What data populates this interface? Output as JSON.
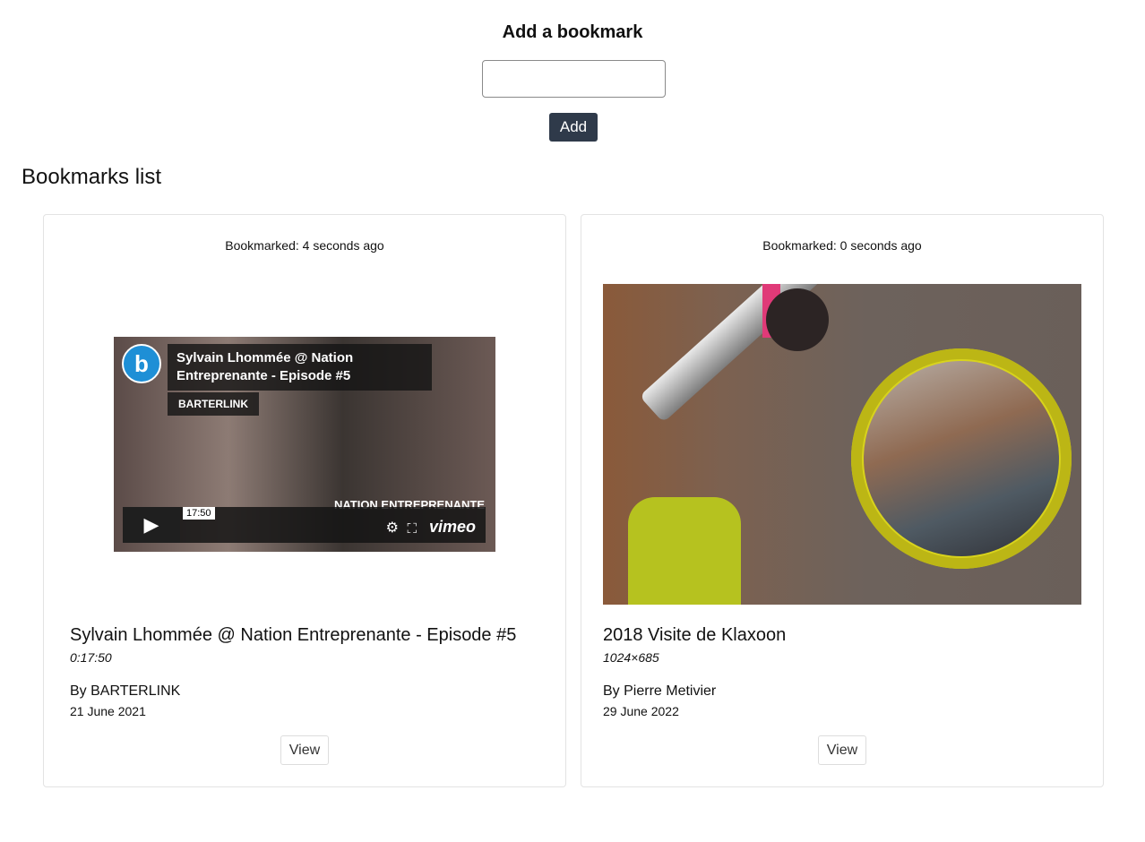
{
  "add_form": {
    "title": "Add a bookmark",
    "input_value": "",
    "input_placeholder": "",
    "add_label": "Add"
  },
  "list": {
    "title": "Bookmarks list",
    "items": [
      {
        "bookmarked": "Bookmarked: 4 seconds ago",
        "title": "Sylvain Lhommée @ Nation Entreprenante - Episode #5",
        "meta": "0:17:50",
        "author": "By BARTERLINK",
        "date": "21 June 2021",
        "view_label": "View",
        "thumbnail": {
          "overlay_title": "Sylvain Lhommée @ Nation Entreprenante - Episode #5",
          "channel": "BARTERLINK",
          "time_tooltip": "17:50",
          "brand": "vimeo",
          "caption": "NATION ENTREPRENANTE"
        }
      },
      {
        "bookmarked": "Bookmarked: 0 seconds ago",
        "title": "2018 Visite de Klaxoon",
        "meta": "1024×685",
        "author": "By Pierre Metivier",
        "date": "29 June 2022",
        "view_label": "View"
      }
    ]
  },
  "colors": {
    "add_button_bg": "#2f3a4a",
    "card_border": "#e3e3e3"
  }
}
